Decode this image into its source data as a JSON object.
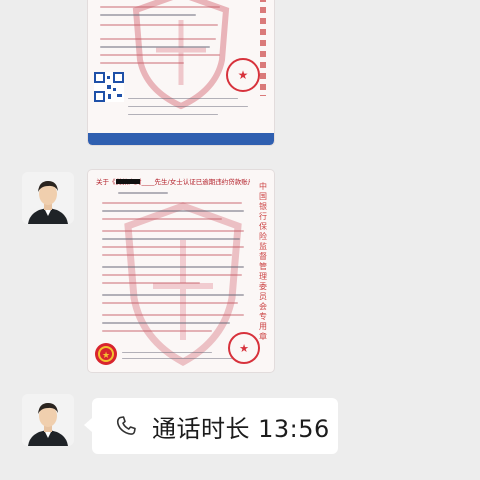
{
  "chat": {
    "message_1": {
      "type": "image",
      "content": "document-screenshot"
    },
    "message_2": {
      "type": "image",
      "content": "document-screenshot",
      "doc_title": "关于《贷款人对____先生/女士认证已逾期违约贷款账户》的通知书",
      "side_text": "中国银行保险监督管理委员会专用章"
    },
    "message_3": {
      "type": "call-record",
      "label": "通话时长 13:56"
    }
  },
  "colors": {
    "background": "#ededed",
    "bubble": "#ffffff",
    "doc_red": "#c0202a",
    "doc_blue": "#2f5fb0"
  },
  "icons": [
    "avatar-icon",
    "phone-icon",
    "qr-code-icon",
    "seal-icon",
    "emblem-icon"
  ]
}
